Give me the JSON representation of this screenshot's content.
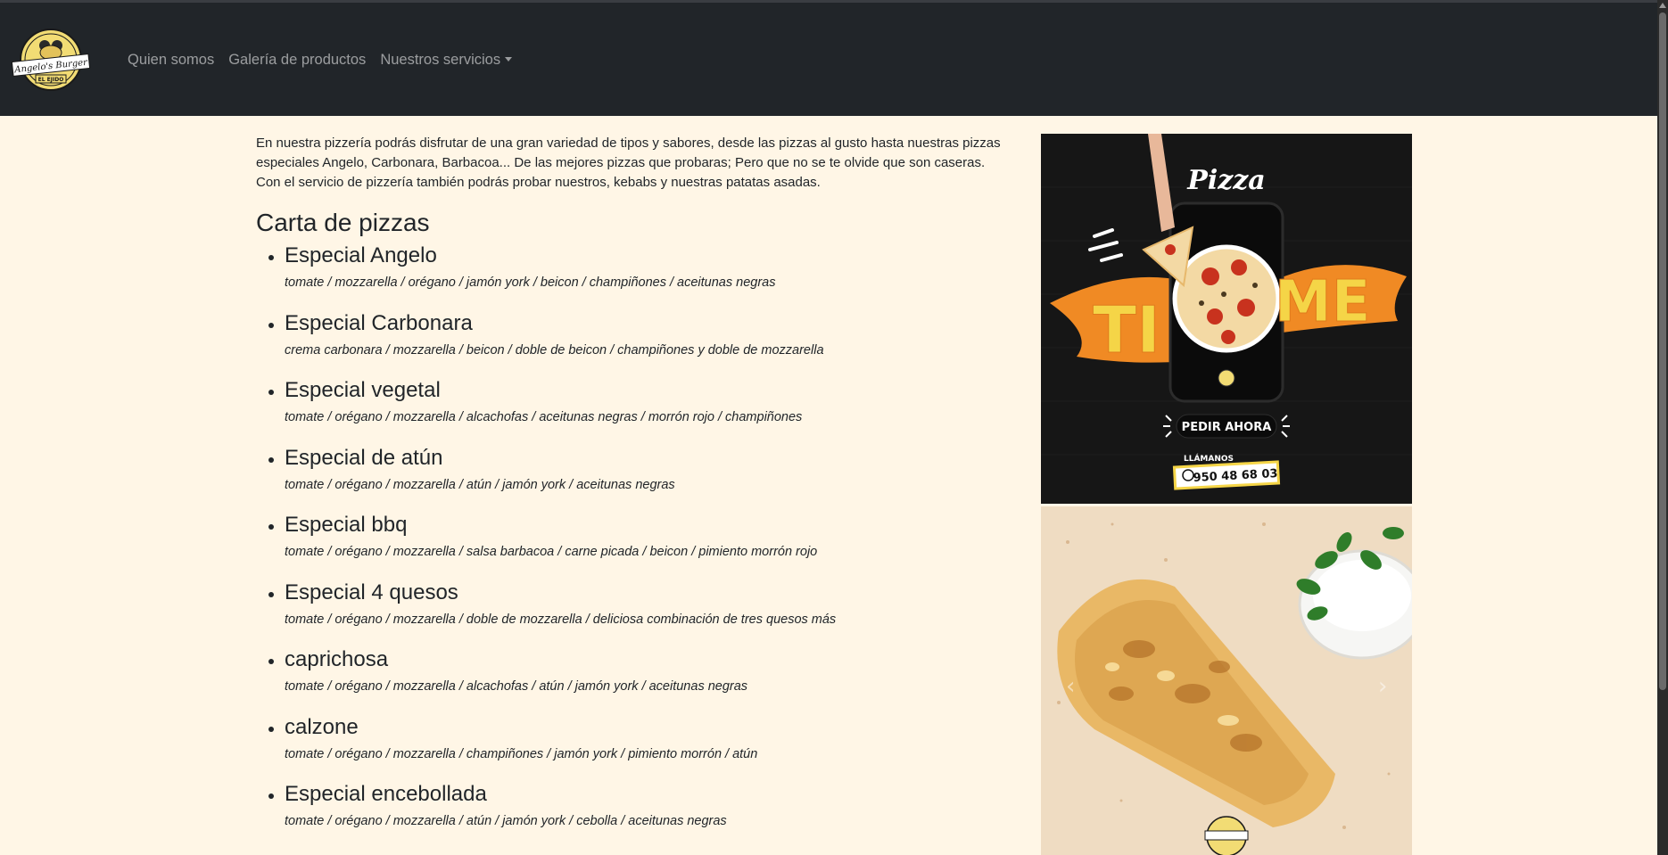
{
  "nav": {
    "logo_text": "Angelo's Burger",
    "logo_sub": "EL EJIDO",
    "links": [
      "Quien somos",
      "Galería de productos",
      "Nuestros servicios"
    ]
  },
  "main": {
    "intro": "En nuestra pizzería podrás disfrutar de una gran variedad de tipos y sabores, desde las pizzas al gusto hasta nuestras pizzas especiales Angelo, Carbonara, Barbacoa... De las mejores pizzas que probaras; Pero que no se te olvide que son caseras. Con el servicio de pizzería también podrás probar nuestros, kebabs y nuestras patatas asadas.",
    "menu_title": "Carta de pizzas",
    "pizzas": [
      {
        "name": "Especial Angelo",
        "ingredients": "tomate / mozzarella / orégano / jamón york / beicon / champiñones / aceitunas negras"
      },
      {
        "name": "Especial Carbonara",
        "ingredients": "crema carbonara / mozzarella / beicon / doble de beicon / champiñones y doble de mozzarella"
      },
      {
        "name": "Especial vegetal",
        "ingredients": "tomate / orégano / mozzarella / alcachofas / aceitunas negras / morrón rojo / champiñones"
      },
      {
        "name": "Especial de atún",
        "ingredients": "tomate / orégano / mozzarella / atún / jamón york / aceitunas negras"
      },
      {
        "name": "Especial bbq",
        "ingredients": "tomate / orégano / mozzarella / salsa barbacoa / carne picada / beicon / pimiento morrón rojo"
      },
      {
        "name": "Especial 4 quesos",
        "ingredients": "tomate / orégano / mozzarella / doble de mozzarella / deliciosa combinación de tres quesos más"
      },
      {
        "name": "caprichosa",
        "ingredients": "tomate / orégano / mozzarella / alcachofas / atún / jamón york / aceitunas negras"
      },
      {
        "name": "calzone",
        "ingredients": "tomate / orégano / mozzarella / champiñones / jamón york / pimiento morrón / atún"
      },
      {
        "name": "Especial encebollada",
        "ingredients": "tomate / orégano / mozzarella / atún / jamón york / cebolla / aceitunas negras"
      }
    ]
  },
  "promo": {
    "title": "Pizza",
    "big_left": "TI",
    "big_right": "ME",
    "button": "PEDIR AHORA",
    "call_label": "LLÁMANOS",
    "phone": "950 48 68 03"
  },
  "colors": {
    "navbar": "#212529",
    "page_bg": "#fff6e6",
    "promo_yellow": "#f5d547",
    "promo_orange": "#f08a24"
  }
}
